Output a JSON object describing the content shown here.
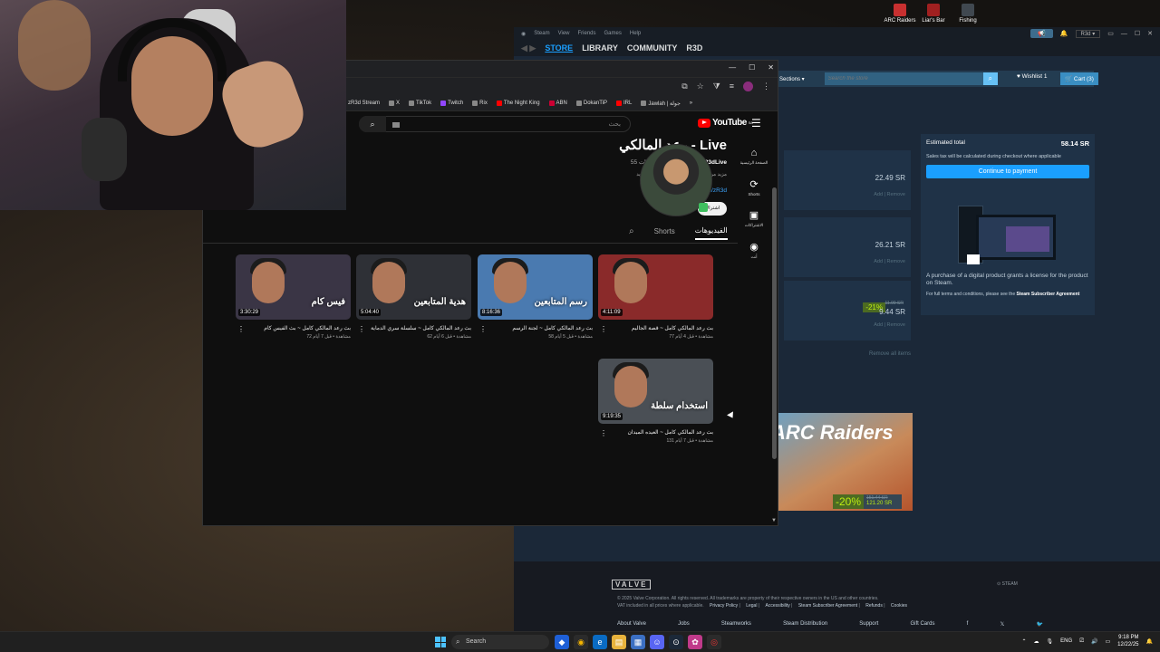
{
  "desktop": {
    "icons": [
      {
        "label": "ARC Raiders",
        "color": "#c83030"
      },
      {
        "label": "Liar's Bar",
        "color": "#a02020"
      },
      {
        "label": "Fishing",
        "color": "#404850"
      }
    ]
  },
  "steam": {
    "menu": [
      "Steam",
      "View",
      "Friends",
      "Games",
      "Help"
    ],
    "nav": [
      "STORE",
      "LIBRARY",
      "COMMUNITY",
      "R3D"
    ],
    "user": "R3d",
    "store_bar": {
      "sections": "Sections",
      "search_placeholder": "Search the store"
    },
    "wishlist": "Wishlist",
    "wishlist_count": "1",
    "cart": "Cart",
    "cart_count": "3",
    "items": [
      {
        "price": "22.49 SR",
        "add": "Add",
        "remove": "Remove"
      },
      {
        "price": "26.21 SR",
        "add": "Add",
        "remove": "Remove"
      },
      {
        "discount": "-21%",
        "old_price": "11.99 SR",
        "price": "9.44 SR",
        "add": "Add",
        "remove": "Remove"
      }
    ],
    "remove_all": "Remove all items",
    "checkout": {
      "estimated_label": "Estimated total",
      "estimated_value": "58.14 SR",
      "tax": "Sales tax will be calculated during checkout where applicable",
      "continue": "Continue to payment",
      "license": "A purchase of a digital product grants a license for the product on Steam.",
      "terms": "For full terms and conditions, please see the",
      "terms_link": "Steam Subscriber Agreement"
    },
    "promo": {
      "title": "ARC Raiders",
      "discount": "-20%",
      "old_price": "151.44 SR",
      "price": "121.20 SR"
    },
    "footer": {
      "valve": "VALVE",
      "steam": "STEAM",
      "copyright": "© 2025 Valve Corporation. All rights reserved. All trademarks are property of their respective owners in the US and other countries.",
      "vat": "VAT included in all prices where applicable.",
      "policy_links": [
        "Privacy Policy",
        "Legal",
        "Accessibility",
        "Steam Subscriber Agreement",
        "Refunds",
        "Cookies"
      ],
      "links": [
        "About Valve",
        "Jobs",
        "Steamworks",
        "Steam Distribution",
        "Support",
        "Gift Cards",
        "f",
        "𝕏",
        "🐦"
      ]
    }
  },
  "browser": {
    "bookmarks": [
      "zR3d Stream",
      "X",
      "TikTok",
      "Twitch",
      "Rix",
      "The Night King",
      "ABN",
      "DokanTiP",
      "IRL",
      "Jawlah | جولة"
    ],
    "youtube": {
      "logo": "YouTube",
      "region": "SA",
      "search_placeholder": "بحث",
      "sidebar": [
        {
          "icon": "⌂",
          "label": "الصفحة الرئيسية"
        },
        {
          "icon": "⟳",
          "label": "Shorts"
        },
        {
          "icon": "▣",
          "label": "الاشتراكات"
        },
        {
          "icon": "◉",
          "label": "أنت"
        }
      ],
      "channel": {
        "name": "رعد المالكي - Live",
        "handle": "@zR3dLive",
        "stats": "55 مشتركًا • 6 فيديوهات",
        "desc": "مزيد من المعلومات حول هذه القناة ...المزيد",
        "link": "linktr.ee/zR3d",
        "subscribe": "اشتراك"
      },
      "tabs": [
        "الفيديوهات",
        "Shorts"
      ],
      "videos": [
        {
          "title": "بث رعد المالكي كامل ~ بث الفيس كام",
          "meta": "72 مشاهدة • قبل 7 أيام",
          "duration": "3:30:29",
          "overlay": "فيس كام",
          "bg": "#3a3545"
        },
        {
          "title": "بث رعد المالكي كامل ~ سلسلة سري الدماية",
          "meta": "62 مشاهدة • قبل 6 أيام",
          "duration": "5:04:40",
          "overlay": "هدية المتابعين",
          "bg": "#2e3036"
        },
        {
          "title": "بث رعد المالكي كامل ~ لجنة الرسم",
          "meta": "58 مشاهدة • قبل 5 أيام",
          "duration": "8:16:36",
          "overlay": "رسم المتابعين",
          "bg": "#4a7ab0"
        },
        {
          "title": "بث رعد المالكي كامل ~ قصة الجاليم",
          "meta": "77 مشاهدة • قبل 4 أيام",
          "duration": "4:11:09",
          "overlay": "",
          "bg": "#8a2a2a"
        },
        {
          "title": "بث رعد المالكي كامل ~ العيده الميدان",
          "meta": "131 مشاهدة • قبل 7 أيام",
          "duration": "9:19:35",
          "overlay": "استخدام سلطة",
          "bg": "#4a4f55"
        }
      ]
    }
  },
  "taskbar": {
    "search": "Search",
    "lang": "ENG",
    "time": "9:18 PM",
    "date": "12/22/25"
  }
}
